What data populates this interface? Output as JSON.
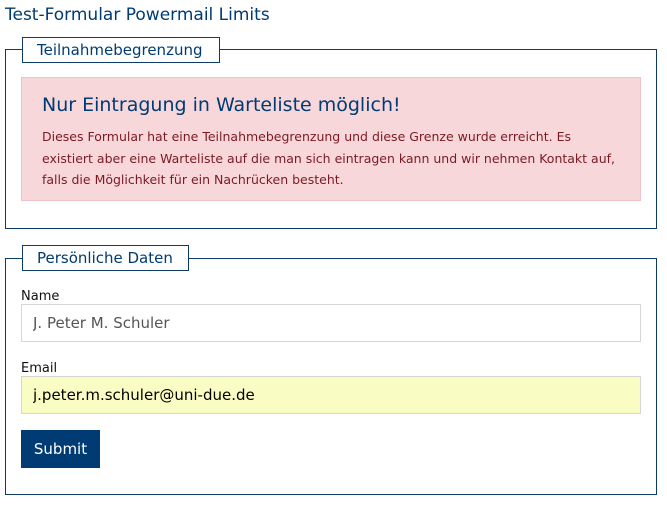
{
  "page": {
    "title": "Test-Formular Powermail Limits"
  },
  "limit_section": {
    "legend": "Teilnahmebegrenzung",
    "alert_title": "Nur Eintragung in Warteliste möglich!",
    "alert_text": "Dieses Formular hat eine Teilnahmebegrenzung und diese Grenze wurde erreicht. Es existiert aber eine Warteliste auf die man sich eintragen kann und wir nehmen Kontakt auf, falls die Möglichkeit für ein Nachrücken besteht."
  },
  "personal_section": {
    "legend": "Persönliche Daten",
    "name_label": "Name",
    "name_value": "J. Peter M. Schuler",
    "email_label": "Email",
    "email_value": "j.peter.m.schuler@uni-due.de",
    "submit_label": "Submit"
  },
  "colors": {
    "brand": "#003b73",
    "alert_bg": "#f7d7da",
    "alert_text": "#7a1a24",
    "autofill_bg": "#fafdc3"
  }
}
